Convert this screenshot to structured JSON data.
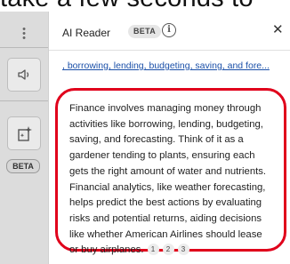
{
  "background": {
    "text": "take a few seconds to"
  },
  "rail": {
    "beta_label": "BETA",
    "icons": [
      "drag-grip",
      "speaker",
      "ai-sparkle-note"
    ]
  },
  "panel": {
    "title": "AI Reader",
    "badge": "BETA",
    "info_glyph": "i",
    "close_glyph": "✕",
    "keywords_link": ", borrowing, lending, budgeting, saving, and fore...",
    "summary": "Finance involves managing money through\nactivities like borrowing, lending, budgeting,\nsaving, and forecasting. Think of it as a\ngardener tending to plants, ensuring each\ngets the right amount of water and nutrients.\nFinancial analytics, like weather forecasting,\nhelps predict the best actions by evaluating\nrisks and potential returns, aiding decisions\nlike whether American Airlines should lease\nor buy airplanes.",
    "citations": [
      "1",
      "2",
      "3"
    ]
  },
  "colors": {
    "highlight": "#e0001b",
    "link": "#1a4fa8",
    "rail": "#dcdcdc"
  }
}
